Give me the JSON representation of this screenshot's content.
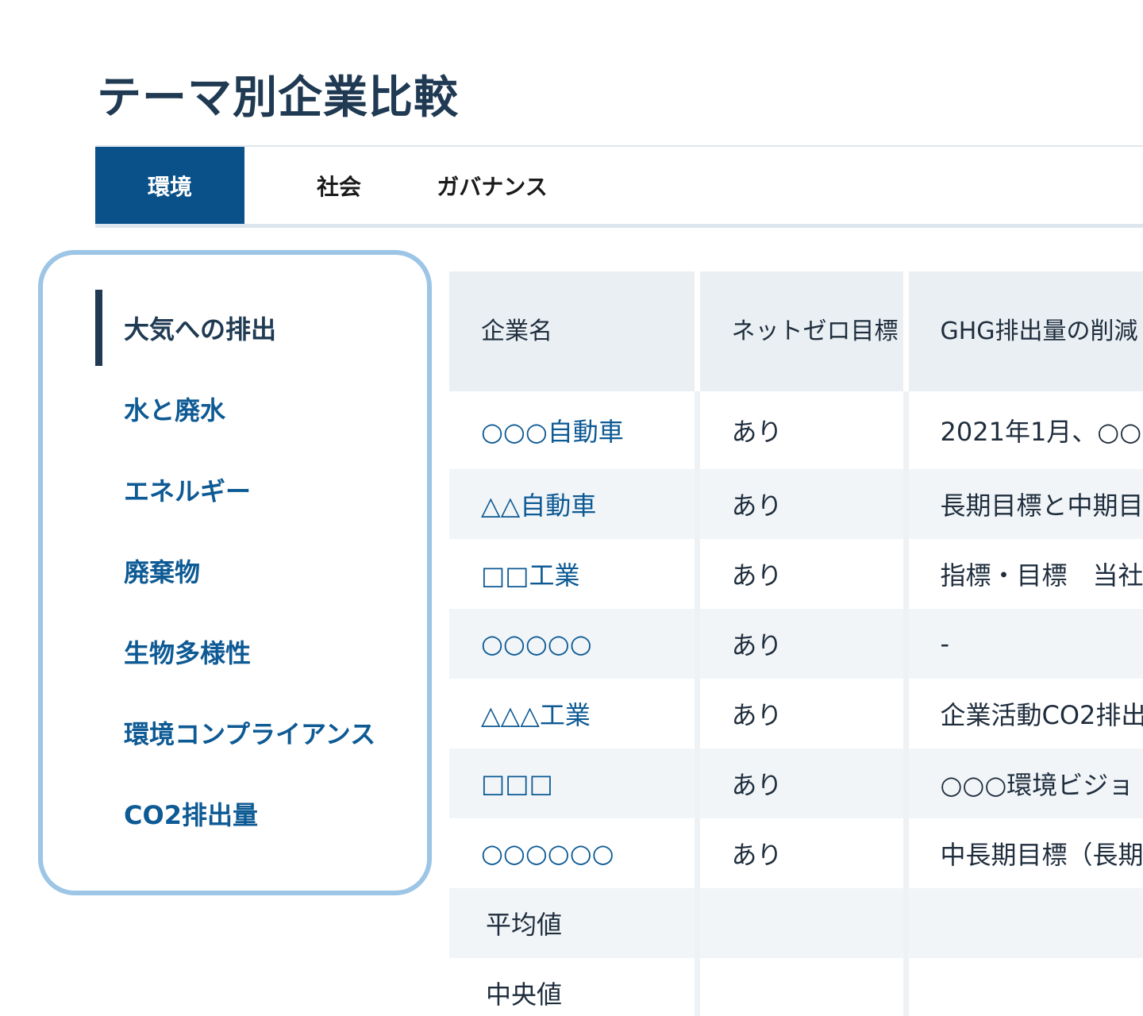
{
  "page": {
    "title": "テーマ別企業比較"
  },
  "tabs": [
    {
      "label": "環境",
      "active": true
    },
    {
      "label": "社会",
      "active": false
    },
    {
      "label": "ガバナンス",
      "active": false
    }
  ],
  "sidebar": {
    "items": [
      {
        "label": "大気への排出",
        "active": true
      },
      {
        "label": "水と廃水",
        "active": false
      },
      {
        "label": "エネルギー",
        "active": false
      },
      {
        "label": "廃棄物",
        "active": false
      },
      {
        "label": "生物多様性",
        "active": false
      },
      {
        "label": "環境コンプライアンス",
        "active": false
      },
      {
        "label": "CO2排出量",
        "active": false
      }
    ]
  },
  "table": {
    "headers": [
      "企業名",
      "ネットゼロ目標",
      "GHG排出量の削減"
    ],
    "rows": [
      {
        "company": "○○○自動車",
        "netzero": "あり",
        "ghg": "2021年1月、○○"
      },
      {
        "company": "△△自動車",
        "netzero": "あり",
        "ghg": "長期目標と中期目"
      },
      {
        "company": "□□工業",
        "netzero": "あり",
        "ghg": "指標・目標　当社"
      },
      {
        "company": "○○○○○",
        "netzero": "あり",
        "ghg": "-"
      },
      {
        "company": "△△△工業",
        "netzero": "あり",
        "ghg": "企業活動CO2排出"
      },
      {
        "company": "□□□",
        "netzero": "あり",
        "ghg": "○○○環境ビジョ"
      },
      {
        "company": "○○○○○○",
        "netzero": "あり",
        "ghg": "中長期目標（長期"
      }
    ],
    "stats": [
      {
        "label": "平均値",
        "netzero": "",
        "ghg": ""
      },
      {
        "label": "中央値",
        "netzero": "",
        "ghg": ""
      }
    ]
  },
  "colors": {
    "primary": "#0a5189",
    "link": "#0d5a94",
    "heading": "#1f3a52",
    "sidebar_border": "#9cc5e6",
    "table_header_bg": "#e9eff3",
    "row_alt_bg": "#f1f5f8"
  }
}
